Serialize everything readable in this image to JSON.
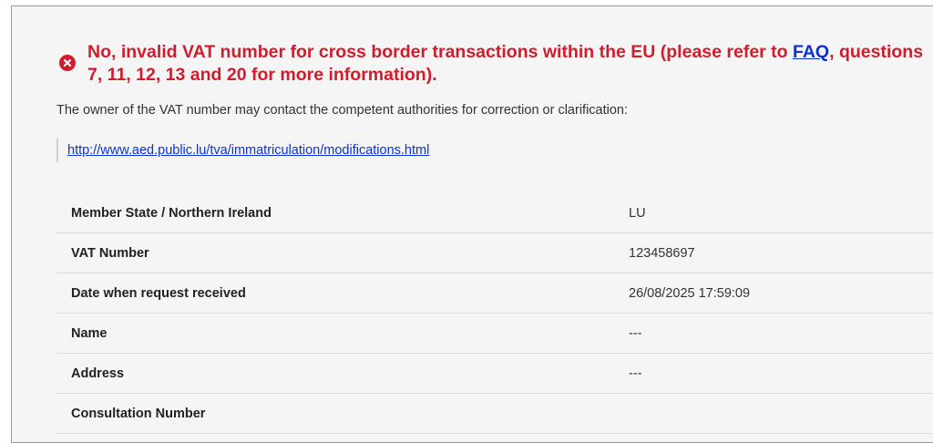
{
  "error": {
    "icon": "error-circle-x-icon",
    "message_before": "No, invalid VAT number for cross border transactions within the EU (please refer to ",
    "faq_link": "FAQ",
    "message_after": ", questions 7, 11, 12, 13 and 20 for more information).",
    "color": "#d21c2c"
  },
  "owner_text": "The owner of the VAT number may contact the competent authorities for correction or clarification:",
  "authority_link": "http://www.aed.public.lu/tva/immatriculation/modifications.html",
  "details": [
    {
      "label": "Member State / Northern Ireland",
      "value": "LU"
    },
    {
      "label": "VAT Number",
      "value": "123458697"
    },
    {
      "label": "Date when request received",
      "value": "26/08/2025 17:59:09"
    },
    {
      "label": "Name",
      "value": "---"
    },
    {
      "label": "Address",
      "value": "---"
    },
    {
      "label": "Consultation Number",
      "value": ""
    }
  ]
}
